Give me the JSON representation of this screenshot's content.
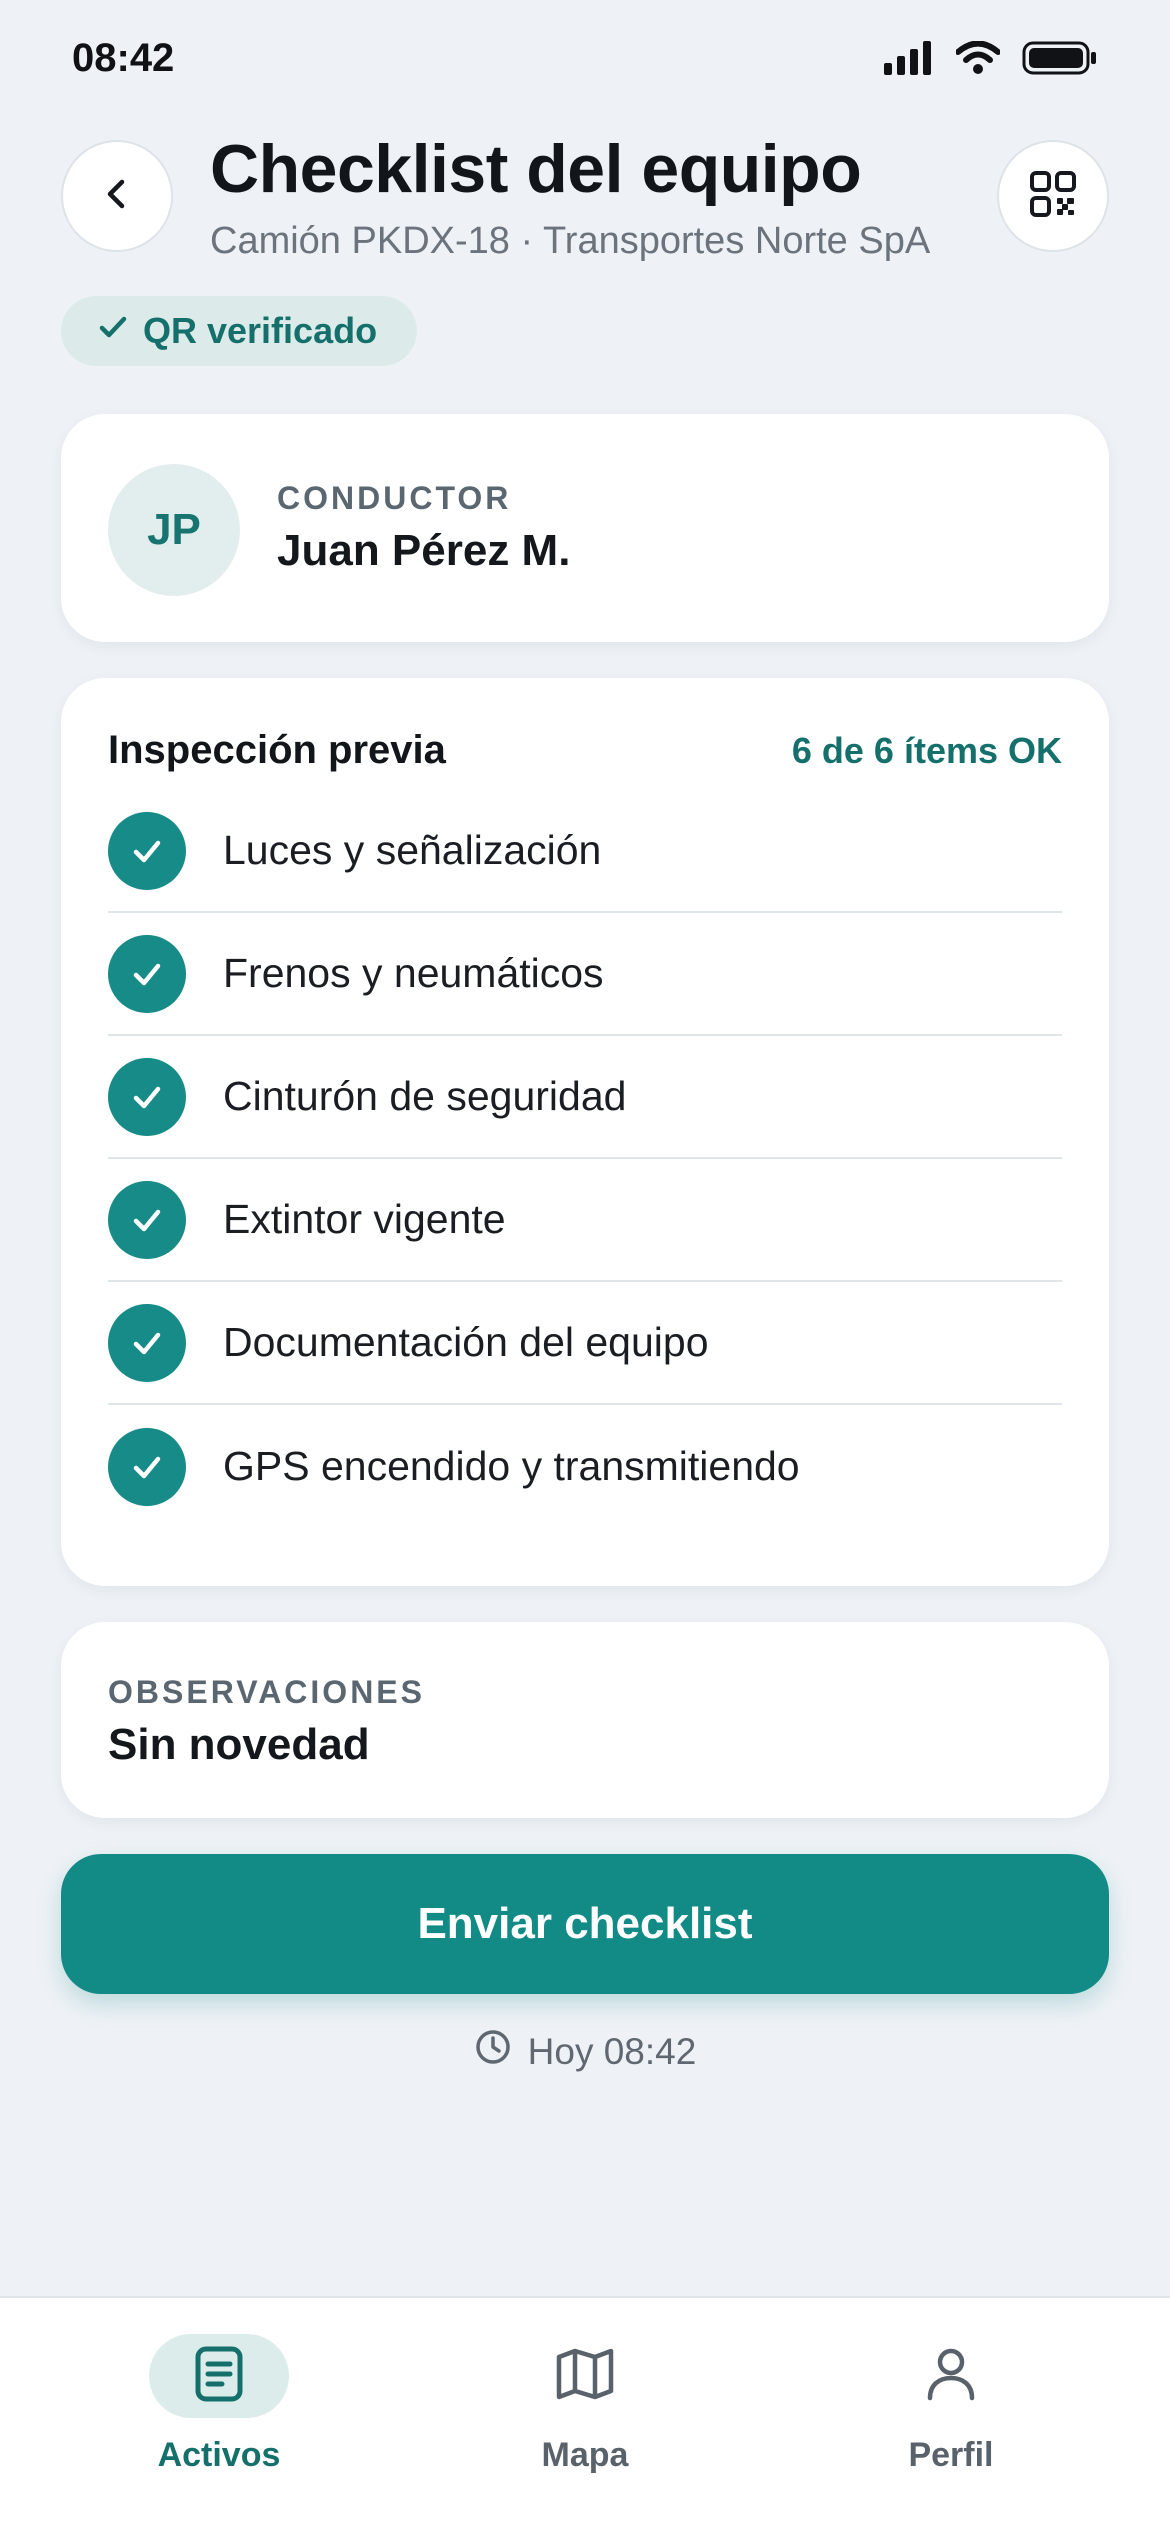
{
  "status_bar": {
    "time": "08:42"
  },
  "header": {
    "title": "Checklist del equipo",
    "subtitle": "Camión PKDX-18 · Transportes Norte SpA"
  },
  "qr_badge": {
    "label": "QR verificado"
  },
  "driver": {
    "initials": "JP",
    "label": "CONDUCTOR",
    "name": "Juan Pérez M."
  },
  "inspection": {
    "title": "Inspección previa",
    "count": "6 de 6 ítems OK",
    "items": [
      {
        "label": "Luces y señalización",
        "checked": true
      },
      {
        "label": "Frenos y neumáticos",
        "checked": true
      },
      {
        "label": "Cinturón de seguridad",
        "checked": true
      },
      {
        "label": "Extintor vigente",
        "checked": true
      },
      {
        "label": "Documentación del equipo",
        "checked": true
      },
      {
        "label": "GPS encendido y transmitiendo",
        "checked": true
      }
    ]
  },
  "observations": {
    "label": "OBSERVACIONES",
    "value": "Sin novedad"
  },
  "submit": {
    "label": "Enviar checklist"
  },
  "timestamp": {
    "text": "Hoy 08:42"
  },
  "tabs": [
    {
      "label": "Activos",
      "icon": "document-icon",
      "active": true
    },
    {
      "label": "Mapa",
      "icon": "map-icon",
      "active": false
    },
    {
      "label": "Perfil",
      "icon": "person-icon",
      "active": false
    }
  ],
  "colors": {
    "accent": "#128a86",
    "accent_text": "#15706c",
    "background": "#eef2f6",
    "card": "#ffffff"
  }
}
